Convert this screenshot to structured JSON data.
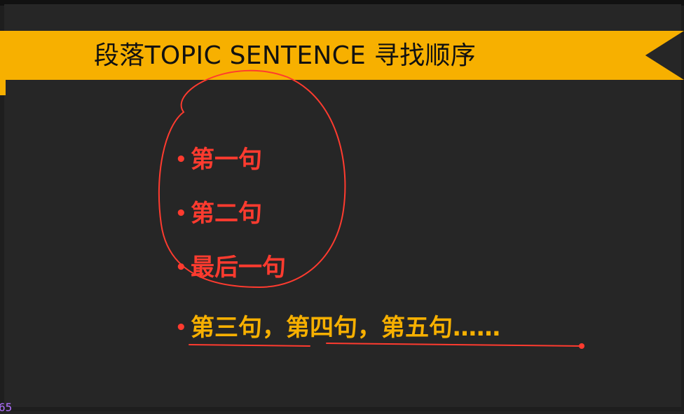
{
  "slide": {
    "title": "段落TOPIC  SENTENCE 寻找顺序",
    "bullets": [
      {
        "text": "第一句",
        "color": "#ff3b2f"
      },
      {
        "text": "第二句",
        "color": "#ff3b2f"
      },
      {
        "text": "最后一句",
        "color": "#ff3b2f"
      },
      {
        "text": "第三句，第四句，第五句……",
        "color": "#f7b000"
      }
    ],
    "bullet_marker": "•"
  },
  "corner_text": "65",
  "colors": {
    "banner": "#f7b000",
    "background": "#262626",
    "annotation": "#ff3b2f"
  }
}
